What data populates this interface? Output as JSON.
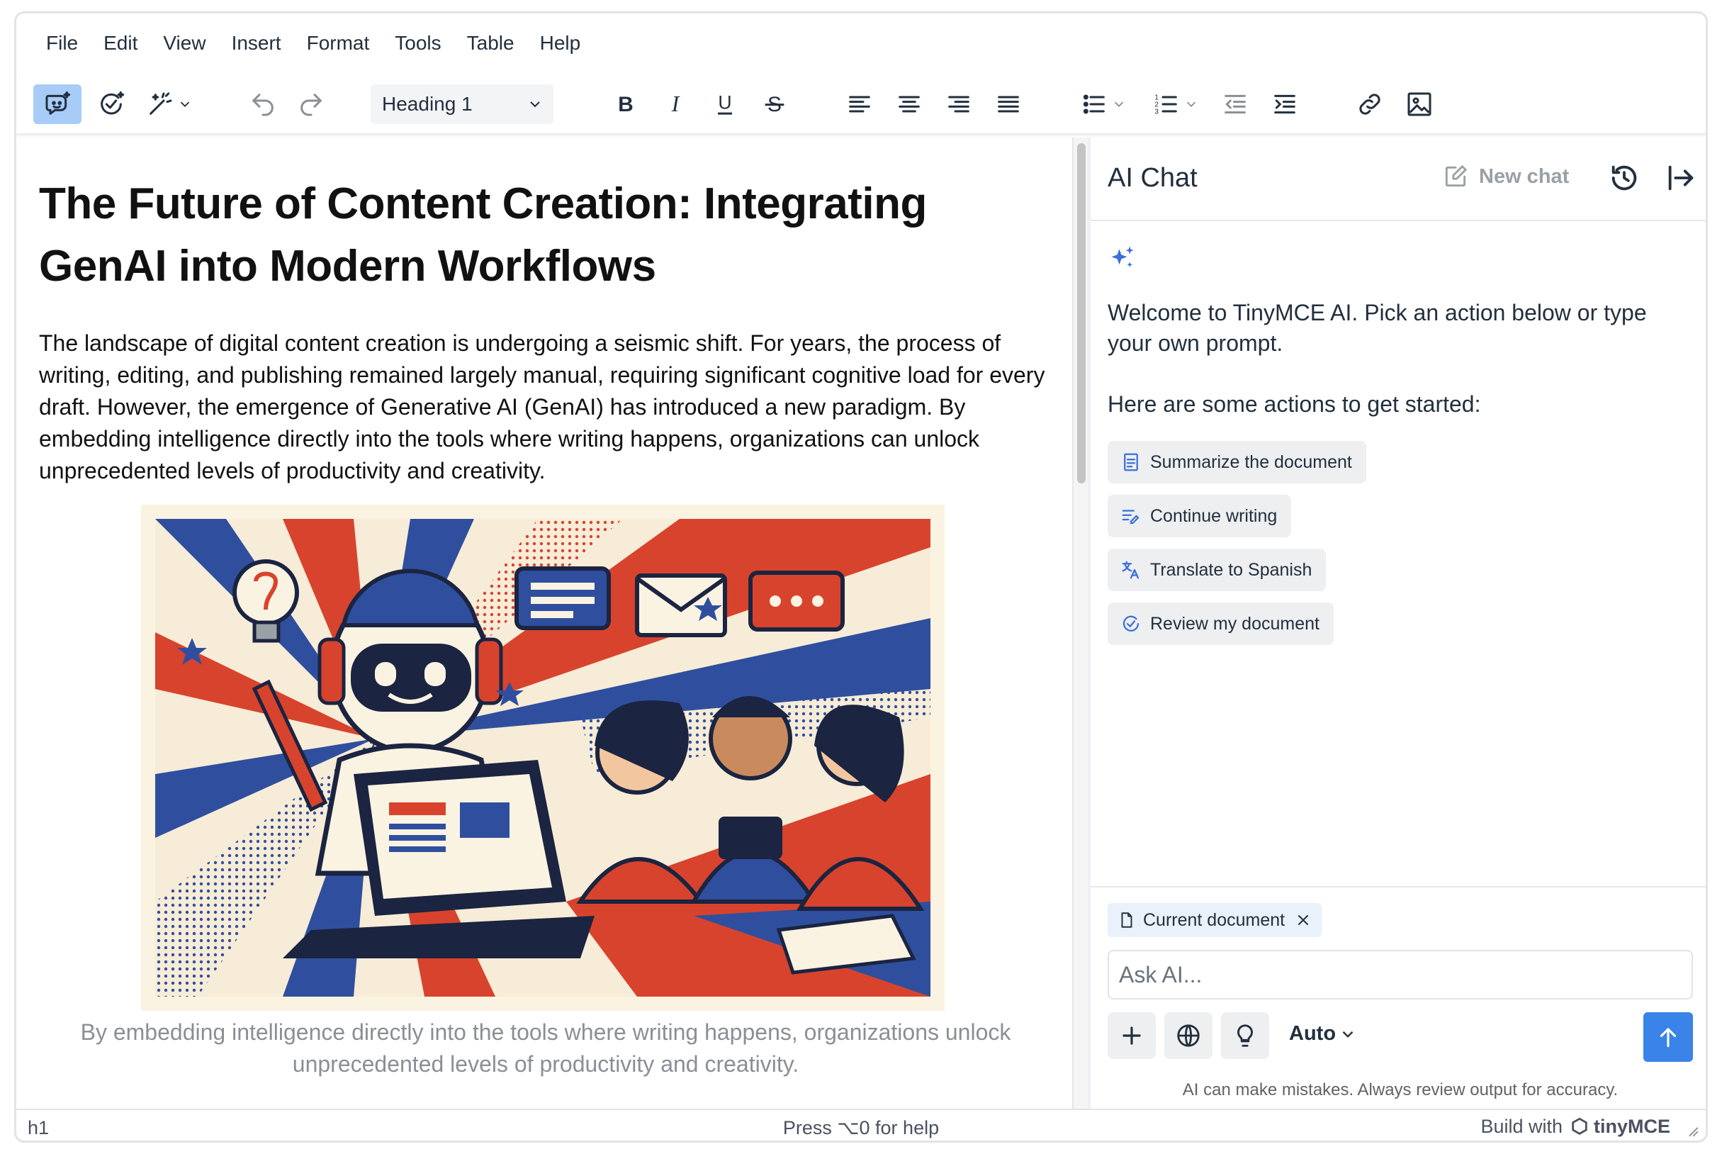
{
  "menubar": [
    "File",
    "Edit",
    "View",
    "Insert",
    "Format",
    "Tools",
    "Table",
    "Help"
  ],
  "toolbar": {
    "block_format": "Heading 1",
    "icons": [
      "ai-chat-icon",
      "ai-review-icon",
      "ai-quick-actions-icon",
      "undo-icon",
      "redo-icon",
      "bold-icon",
      "italic-icon",
      "underline-icon",
      "strikethrough-icon",
      "align-left-icon",
      "align-center-icon",
      "align-right-icon",
      "align-justify-icon",
      "bullet-list-icon",
      "numbered-list-icon",
      "outdent-icon",
      "indent-icon",
      "link-icon",
      "image-icon"
    ],
    "active_color": "#a6ccf7"
  },
  "document": {
    "title": "The Future of Content Creation: Integrating GenAI into Modern Workflows",
    "paragraph": "The landscape of digital content creation is undergoing a seismic shift. For years, the process of writing, editing, and publishing remained largely manual, requiring significant cognitive load for every draft. However, the emergence of Generative AI (GenAI) has introduced a new paradigm. By embedding intelligence directly into the tools where writing happens, organizations can unlock unprecedented levels of productivity and creativity.",
    "caption": "By embedding intelligence directly into the tools where writing happens, organizations unlock unprecedented levels of productivity and creativity."
  },
  "ai_chat": {
    "title": "AI Chat",
    "new_chat_label": "New chat",
    "welcome": "Welcome to TinyMCE AI. Pick an action below or type your own prompt.",
    "actions_intro": "Here are some actions to get started:",
    "actions": [
      {
        "label": "Summarize the document",
        "icon": "summarize-icon"
      },
      {
        "label": "Continue writing",
        "icon": "continue-writing-icon"
      },
      {
        "label": "Translate to Spanish",
        "icon": "translate-icon"
      },
      {
        "label": "Review my document",
        "icon": "review-icon"
      }
    ],
    "context_chip": "Current document",
    "input_placeholder": "Ask AI...",
    "model_select": "Auto",
    "disclaimer": "AI can make mistakes. Always review output for accuracy.",
    "send_color": "#3a83e8"
  },
  "statusbar": {
    "path": "h1",
    "help": "Press ⌥0 for help",
    "brand_prefix": "Build with",
    "brand_name": "tinyMCE"
  }
}
